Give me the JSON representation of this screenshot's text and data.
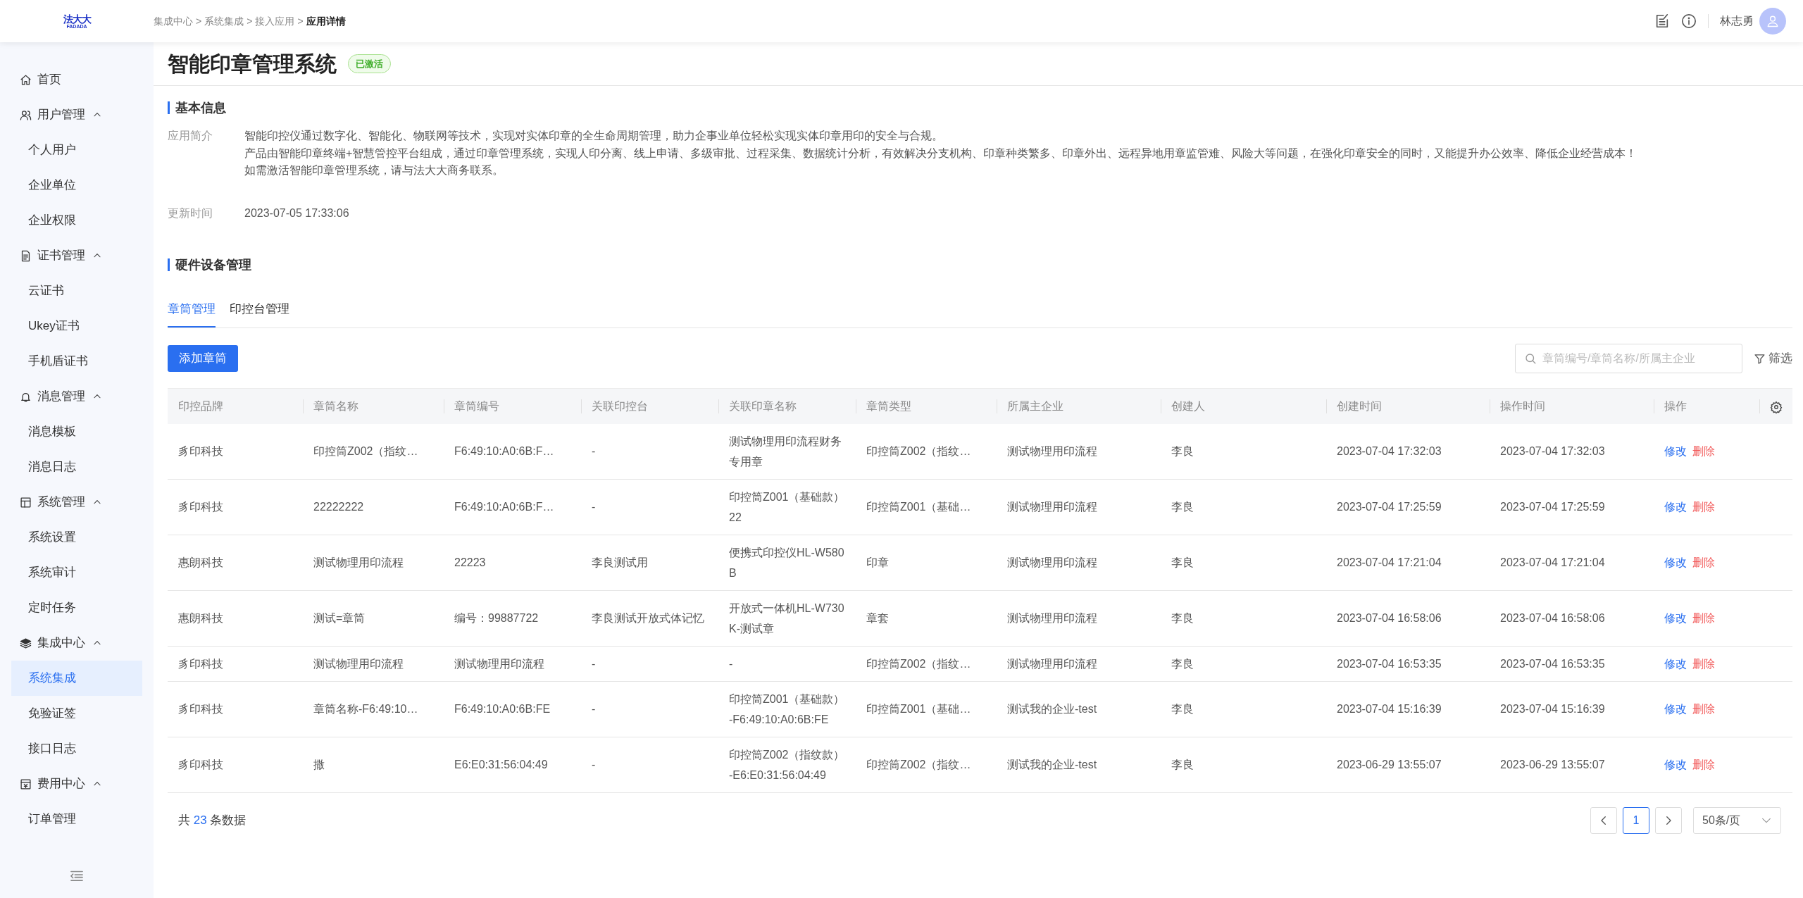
{
  "logo": {
    "text": "法大大",
    "subtext": "FADADA"
  },
  "breadcrumb": [
    {
      "label": "集成中心",
      "current": false,
      "separator": ">"
    },
    {
      "label": "系统集成",
      "current": false,
      "separator": ">"
    },
    {
      "label": "接入应用",
      "current": false,
      "separator": ">"
    },
    {
      "label": "应用详情",
      "current": true
    }
  ],
  "header": {
    "user_name": "林志勇"
  },
  "sidebar": {
    "items": [
      {
        "label": "首页",
        "kind": "home"
      },
      {
        "label": "用户管理",
        "kind": "users",
        "expanded": true,
        "children": [
          {
            "label": "个人用户",
            "selected": false
          },
          {
            "label": "企业单位",
            "selected": false
          },
          {
            "label": "企业权限",
            "selected": false
          }
        ]
      },
      {
        "label": "证书管理",
        "kind": "document",
        "expanded": true,
        "children": [
          {
            "label": "云证书",
            "selected": false
          },
          {
            "label": "Ukey证书",
            "selected": false
          },
          {
            "label": "手机盾证书",
            "selected": false
          }
        ]
      },
      {
        "label": "消息管理",
        "kind": "bell",
        "expanded": true,
        "children": [
          {
            "label": "消息模板",
            "selected": false
          },
          {
            "label": "消息日志",
            "selected": false
          }
        ]
      },
      {
        "label": "系统管理",
        "kind": "layout",
        "expanded": true,
        "children": [
          {
            "label": "系统设置",
            "selected": false
          },
          {
            "label": "系统审计",
            "selected": false
          },
          {
            "label": "定时任务",
            "selected": false
          }
        ]
      },
      {
        "label": "集成中心",
        "kind": "layers",
        "expanded": true,
        "children": [
          {
            "label": "系统集成",
            "selected": true
          },
          {
            "label": "免验证签",
            "selected": false
          },
          {
            "label": "接口日志",
            "selected": false
          }
        ]
      },
      {
        "label": "费用中心",
        "kind": "invoice",
        "expanded": true,
        "children": [
          {
            "label": "订单管理",
            "selected": false
          }
        ]
      }
    ]
  },
  "page": {
    "title": "智能印章管理系统",
    "status_badge": "已激活"
  },
  "basic_info": {
    "heading": "基本信息",
    "fields": [
      {
        "label": "应用简介",
        "lines": [
          "智能印控仪通过数字化、智能化、物联网等技术，实现对实体印章的全生命周期管理，助力企事业单位轻松实现实体印章用印的安全与合规。",
          "产品由智能印章终端+智慧管控平台组成，通过印章管理系统，实现人印分离、线上申请、多级审批、过程采集、数据统计分析，有效解决分支机构、印章种类繁多、印章外出、远程异地用章监管难、风险大等问题，在强化印章安全的同时，又能提升办公效率、降低企业经营成本！",
          "如需激活智能印章管理系统，请与法大大商务联系。"
        ]
      },
      {
        "label": "更新时间",
        "lines": [
          "2023-07-05 17:33:06"
        ]
      }
    ]
  },
  "hardware": {
    "heading": "硬件设备管理",
    "tabs": [
      {
        "label": "章筒管理",
        "selected": true
      },
      {
        "label": "印控台管理",
        "selected": false
      }
    ],
    "add_button": "添加章筒",
    "search": {
      "placeholder": "章筒编号/章筒名称/所属主企业"
    },
    "filter_button": "筛选",
    "table": {
      "columns": [
        "印控品牌",
        "章筒名称",
        "章筒编号",
        "关联印控台",
        "关联印章名称",
        "章筒类型",
        "所属主企业",
        "创建人",
        "创建时间",
        "操作时间",
        "操作"
      ],
      "rows": [
        {
          "cells": [
            "豸印科技",
            "印控筒Z002（指纹…",
            "F6:49:10:A0:6B:F…",
            "-",
            "测试物理用印流程财务专用章",
            "印控筒Z002（指纹…",
            "测试物理用印流程",
            "李良",
            "2023-07-04 17:32:03",
            "2023-07-04 17:32:03"
          ],
          "actions": [
            {
              "label": "修改",
              "kind": "edit"
            },
            {
              "label": "删除",
              "kind": "delete"
            }
          ]
        },
        {
          "cells": [
            "豸印科技",
            "22222222",
            "F6:49:10:A0:6B:F…",
            "-",
            "印控筒Z001（基础款）22",
            "印控筒Z001（基础…",
            "测试物理用印流程",
            "李良",
            "2023-07-04 17:25:59",
            "2023-07-04 17:25:59"
          ],
          "actions": [
            {
              "label": "修改",
              "kind": "edit"
            },
            {
              "label": "删除",
              "kind": "delete"
            }
          ]
        },
        {
          "cells": [
            "惠朗科技",
            "测试物理用印流程",
            "22223",
            "李良测试用",
            "便携式印控仪HL-W580B",
            "印章",
            "测试物理用印流程",
            "李良",
            "2023-07-04 17:21:04",
            "2023-07-04 17:21:04"
          ],
          "actions": [
            {
              "label": "修改",
              "kind": "edit"
            },
            {
              "label": "删除",
              "kind": "delete"
            }
          ]
        },
        {
          "cells": [
            "惠朗科技",
            "测试=章筒",
            "编号：99887722",
            "李良测试开放式体记忆",
            "开放式一体机HL-W730K-测试章",
            "章套",
            "测试物理用印流程",
            "李良",
            "2023-07-04 16:58:06",
            "2023-07-04 16:58:06"
          ],
          "actions": [
            {
              "label": "修改",
              "kind": "edit"
            },
            {
              "label": "删除",
              "kind": "delete"
            }
          ]
        },
        {
          "cells": [
            "豸印科技",
            "测试物理用印流程",
            "测试物理用印流程",
            "-",
            "-",
            "印控筒Z002（指纹…",
            "测试物理用印流程",
            "李良",
            "2023-07-04 16:53:35",
            "2023-07-04 16:53:35"
          ],
          "actions": [
            {
              "label": "修改",
              "kind": "edit"
            },
            {
              "label": "删除",
              "kind": "delete"
            }
          ]
        },
        {
          "cells": [
            "豸印科技",
            "章筒名称-F6:49:10…",
            "F6:49:10:A0:6B:FE",
            "-",
            "印控筒Z001（基础款）-F6:49:10:A0:6B:FE",
            "印控筒Z001（基础…",
            "测试我的企业-test",
            "李良",
            "2023-07-04 15:16:39",
            "2023-07-04 15:16:39"
          ],
          "actions": [
            {
              "label": "修改",
              "kind": "edit"
            },
            {
              "label": "删除",
              "kind": "delete"
            }
          ]
        },
        {
          "cells": [
            "豸印科技",
            "撒",
            "E6:E0:31:56:04:49",
            "-",
            "印控筒Z002（指纹款）-E6:E0:31:56:04:49",
            "印控筒Z002（指纹…",
            "测试我的企业-test",
            "李良",
            "2023-06-29 13:55:07",
            "2023-06-29 13:55:07"
          ],
          "actions": [
            {
              "label": "修改",
              "kind": "edit"
            },
            {
              "label": "删除",
              "kind": "delete"
            }
          ]
        }
      ]
    },
    "pagination": {
      "total_prefix": "共",
      "total": "23",
      "total_suffix": "条数据",
      "pages": [
        {
          "label": "1",
          "selected": true
        }
      ],
      "page_size": "50条/页"
    }
  }
}
